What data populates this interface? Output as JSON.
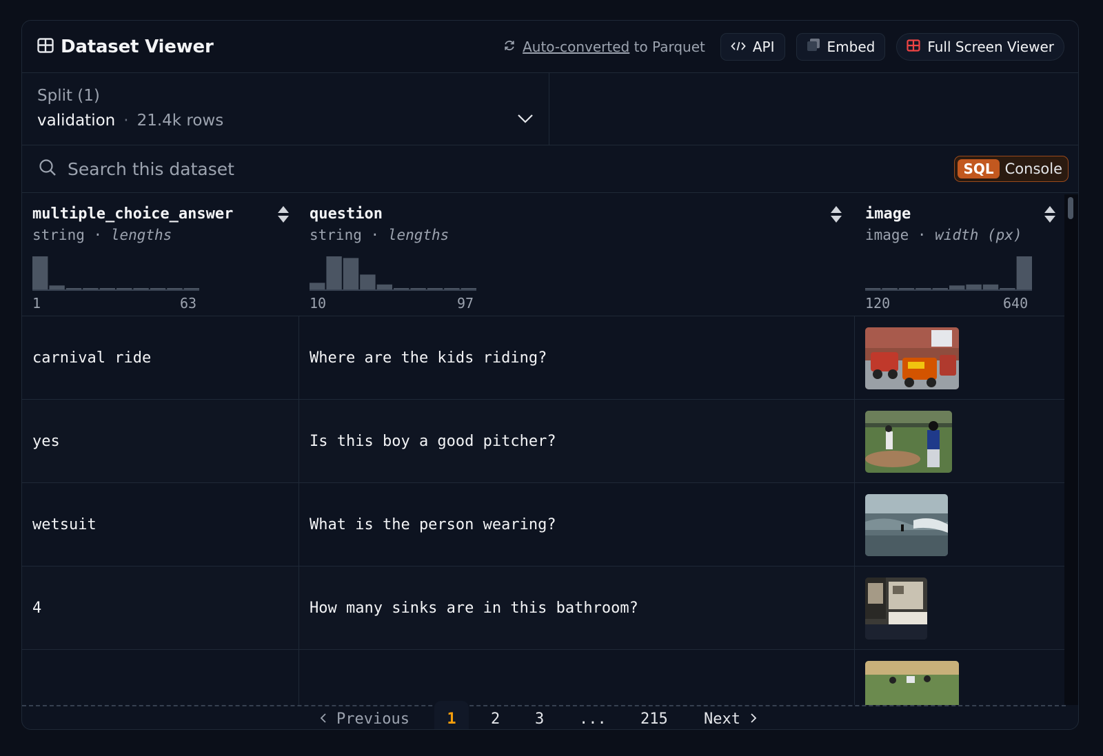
{
  "header": {
    "title": "Dataset Viewer",
    "parquet_link": "Auto-converted",
    "parquet_suffix": "to Parquet",
    "api_label": "API",
    "embed_label": "Embed",
    "fullscreen_label": "Full Screen Viewer"
  },
  "split": {
    "label": "Split (1)",
    "name": "validation",
    "rows": "21.4k rows"
  },
  "search": {
    "placeholder": "Search this dataset",
    "sql_tag": "SQL",
    "sql_label": "Console"
  },
  "columns": [
    {
      "name": "multiple_choice_answer",
      "type": "string",
      "stat": "lengths",
      "min": "1",
      "max": "63",
      "hist": [
        1.0,
        0.12,
        0.04,
        0.04,
        0.04,
        0.04,
        0.04,
        0.04,
        0.04,
        0.04
      ]
    },
    {
      "name": "question",
      "type": "string",
      "stat": "lengths",
      "min": "10",
      "max": "97",
      "hist": [
        0.2,
        1.0,
        0.95,
        0.45,
        0.15,
        0.04,
        0.04,
        0.04,
        0.04,
        0.04
      ]
    },
    {
      "name": "image",
      "type": "image",
      "stat": "width (px)",
      "min": "120",
      "max": "640",
      "hist": [
        0.04,
        0.04,
        0.04,
        0.04,
        0.04,
        0.12,
        0.15,
        0.15,
        0.04,
        1.0
      ]
    }
  ],
  "rows": [
    {
      "answer": "carnival ride",
      "question": "Where are the kids riding?",
      "image_icon": "fire-truck-ride-photo"
    },
    {
      "answer": "yes",
      "question": "Is this boy a good pitcher?",
      "image_icon": "baseball-photo"
    },
    {
      "answer": "wetsuit",
      "question": "What is the person wearing?",
      "image_icon": "surfer-photo"
    },
    {
      "answer": "4",
      "question": "How many sinks are in this bathroom?",
      "image_icon": "bathroom-photo"
    },
    {
      "answer": "",
      "question": "",
      "image_icon": "outdoor-photo"
    }
  ],
  "pagination": {
    "prev_label": "Previous",
    "pages": [
      "1",
      "2",
      "3",
      "...",
      "215"
    ],
    "active_page": "1",
    "next_label": "Next"
  },
  "colors": {
    "accent_orange": "#c2581f",
    "active_page": "#f59e0b",
    "fullscreen_icon": "#ef4444",
    "histogram_bar": "#4b5563"
  }
}
